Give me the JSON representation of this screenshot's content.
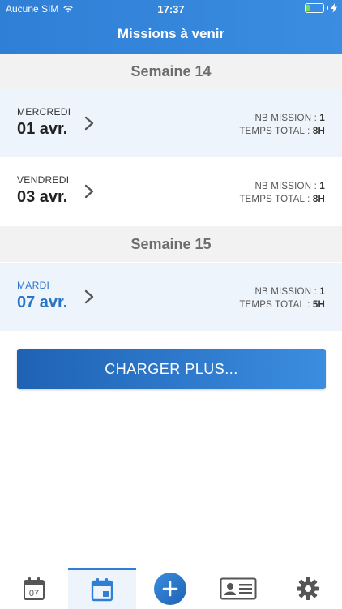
{
  "status_bar": {
    "carrier": "Aucune SIM",
    "time": "17:37"
  },
  "header": {
    "title": "Missions à venir"
  },
  "weeks": [
    {
      "label": "Semaine 14",
      "days": [
        {
          "day": "MERCREDI",
          "date": "01 avr.",
          "missions_label": "NB MISSION : ",
          "missions": "1",
          "time_label": "TEMPS TOTAL : ",
          "time": "8H"
        },
        {
          "day": "VENDREDI",
          "date": "03 avr.",
          "missions_label": "NB MISSION : ",
          "missions": "1",
          "time_label": "TEMPS TOTAL : ",
          "time": "8H"
        }
      ]
    },
    {
      "label": "Semaine 15",
      "days": [
        {
          "day": "MARDI",
          "date": "07 avr.",
          "missions_label": "NB MISSION : ",
          "missions": "1",
          "time_label": "TEMPS TOTAL : ",
          "time": "5H"
        }
      ]
    }
  ],
  "load_more_label": "CHARGER PLUS...",
  "tabbar": {
    "calendar_day_number": "07",
    "tabs": [
      {
        "icon": "calendar-day-icon"
      },
      {
        "icon": "calendar-week-icon",
        "active": true
      },
      {
        "icon": "plus-icon"
      },
      {
        "icon": "id-card-icon"
      },
      {
        "icon": "gear-icon"
      }
    ]
  },
  "colors": {
    "primary": "#2f7fd6",
    "today": "#2a74c7",
    "row_alt": "#eef4fc",
    "week_bg": "#f2f2f2"
  }
}
